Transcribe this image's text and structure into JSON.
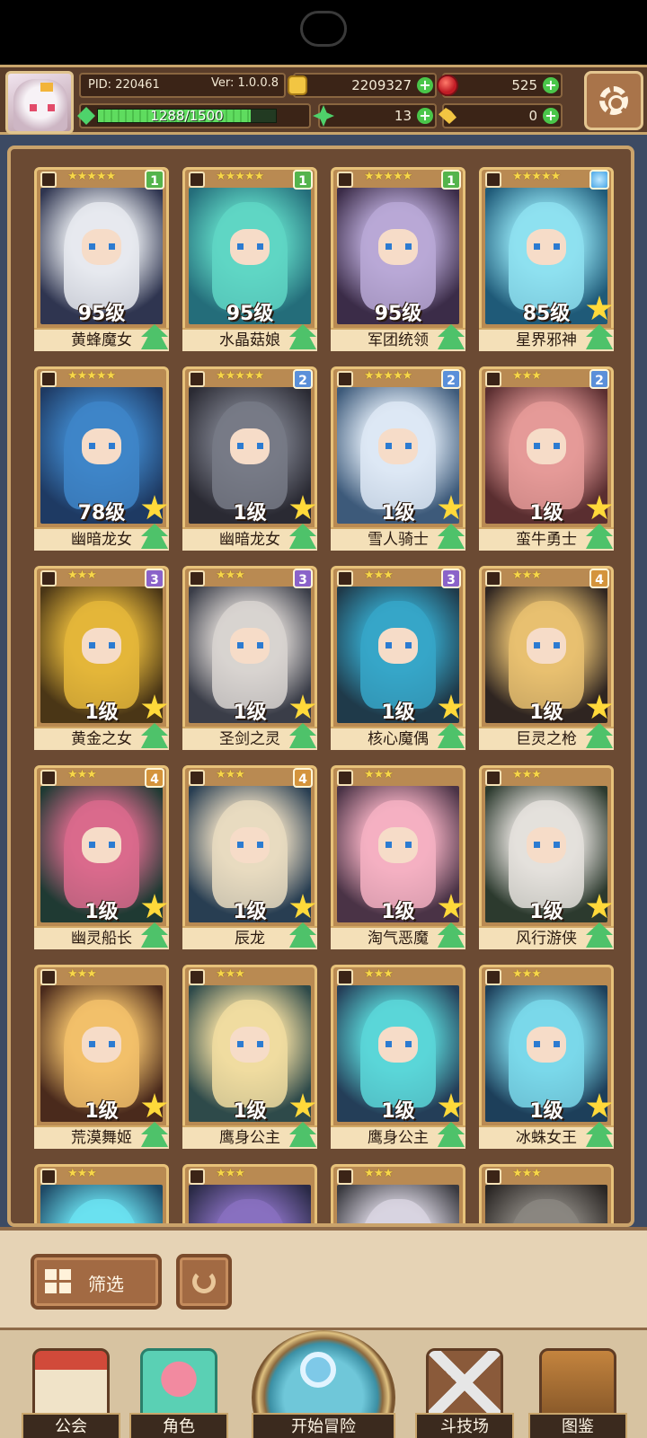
{
  "header": {
    "pid": "PID: 220461",
    "version": "Ver: 1.0.0.8",
    "gold": "2209327",
    "ruby": "525",
    "exp_text": "1288/1500",
    "exp_progress": 0.859,
    "clover": "13",
    "key": "0"
  },
  "cards": [
    {
      "name": "黄蜂魔女",
      "level": "95级",
      "stars": "★★★★★",
      "badge": "1",
      "palette": [
        "#2f3550",
        "#e6e9ee"
      ]
    },
    {
      "name": "水晶菇娘",
      "level": "95级",
      "stars": "★★★★★",
      "badge": "1",
      "palette": [
        "#246d7a",
        "#5fd6c4"
      ]
    },
    {
      "name": "军团统领",
      "level": "95级",
      "stars": "★★★★★",
      "badge": "1",
      "palette": [
        "#3b2c48",
        "#b8a8d6"
      ]
    },
    {
      "name": "星界邪神",
      "level": "85级",
      "stars": "★★★★★",
      "badge": "",
      "palette": [
        "#1f5a78",
        "#8ee0f0"
      ]
    },
    {
      "name": "幽暗龙女",
      "level": "78级",
      "stars": "★★★★★",
      "badge": "",
      "palette": [
        "#1e3a63",
        "#3e85c8"
      ]
    },
    {
      "name": "幽暗龙女",
      "level": "1级",
      "stars": "★★★★★",
      "badge": "2",
      "palette": [
        "#2a2a33",
        "#777a86"
      ]
    },
    {
      "name": "雪人骑士",
      "level": "1级",
      "stars": "★★★★★",
      "badge": "2",
      "palette": [
        "#3d5a7a",
        "#dde8f4"
      ]
    },
    {
      "name": "蛮牛勇士",
      "level": "1级",
      "stars": "★★★",
      "badge": "2",
      "palette": [
        "#5a2e30",
        "#e59a98"
      ]
    },
    {
      "name": "黄金之女",
      "level": "1级",
      "stars": "★★★",
      "badge": "3",
      "palette": [
        "#4a3616",
        "#e4b63a"
      ]
    },
    {
      "name": "圣剑之灵",
      "level": "1级",
      "stars": "★★★",
      "badge": "3",
      "palette": [
        "#3a3d48",
        "#d8d3d0"
      ]
    },
    {
      "name": "核心魔偶",
      "level": "1级",
      "stars": "★★★",
      "badge": "3",
      "palette": [
        "#1f3a4a",
        "#36a6c8"
      ]
    },
    {
      "name": "巨灵之枪",
      "level": "1级",
      "stars": "★★★",
      "badge": "4",
      "palette": [
        "#2f2521",
        "#e8c070"
      ]
    },
    {
      "name": "幽灵船长",
      "level": "1级",
      "stars": "★★★",
      "badge": "4",
      "palette": [
        "#1f3a33",
        "#d96a8c"
      ]
    },
    {
      "name": "辰龙",
      "level": "1级",
      "stars": "★★★",
      "badge": "4",
      "palette": [
        "#283e52",
        "#e8dac0"
      ]
    },
    {
      "name": "淘气恶魔",
      "level": "1级",
      "stars": "★★★",
      "badge": "",
      "palette": [
        "#4a3346",
        "#f4b0c2"
      ]
    },
    {
      "name": "风行游侠",
      "level": "1级",
      "stars": "★★★",
      "badge": "",
      "palette": [
        "#2c3a2e",
        "#e4e0dc"
      ]
    },
    {
      "name": "荒漠舞姬",
      "level": "1级",
      "stars": "★★★",
      "badge": "",
      "palette": [
        "#4a2a1c",
        "#f2c06a"
      ]
    },
    {
      "name": "鹰身公主",
      "level": "1级",
      "stars": "★★★",
      "badge": "",
      "palette": [
        "#2e4a4a",
        "#f0dca0"
      ]
    },
    {
      "name": "鹰身公主",
      "level": "1级",
      "stars": "★★★",
      "badge": "",
      "palette": [
        "#243e58",
        "#5ad6d8"
      ]
    },
    {
      "name": "冰蛛女王",
      "level": "1级",
      "stars": "★★★",
      "badge": "",
      "palette": [
        "#1d3f5a",
        "#7ad8ea"
      ]
    },
    {
      "name": "",
      "level": "",
      "stars": "★★★",
      "badge": "",
      "palette": [
        "#1f4a66",
        "#6ae0f0"
      ]
    },
    {
      "name": "",
      "level": "",
      "stars": "★★★",
      "badge": "",
      "palette": [
        "#2a2a46",
        "#8870c0"
      ]
    },
    {
      "name": "",
      "level": "",
      "stars": "★★★",
      "badge": "",
      "palette": [
        "#3a3a40",
        "#d8d4e0"
      ]
    },
    {
      "name": "",
      "level": "",
      "stars": "★★★",
      "badge": "",
      "palette": [
        "#2a2624",
        "#8a8680"
      ]
    }
  ],
  "controls": {
    "filter_label": "筛选"
  },
  "nav": {
    "guild": "公会",
    "role": "角色",
    "adventure": "开始冒险",
    "arena": "斗技场",
    "codex": "图鉴"
  }
}
